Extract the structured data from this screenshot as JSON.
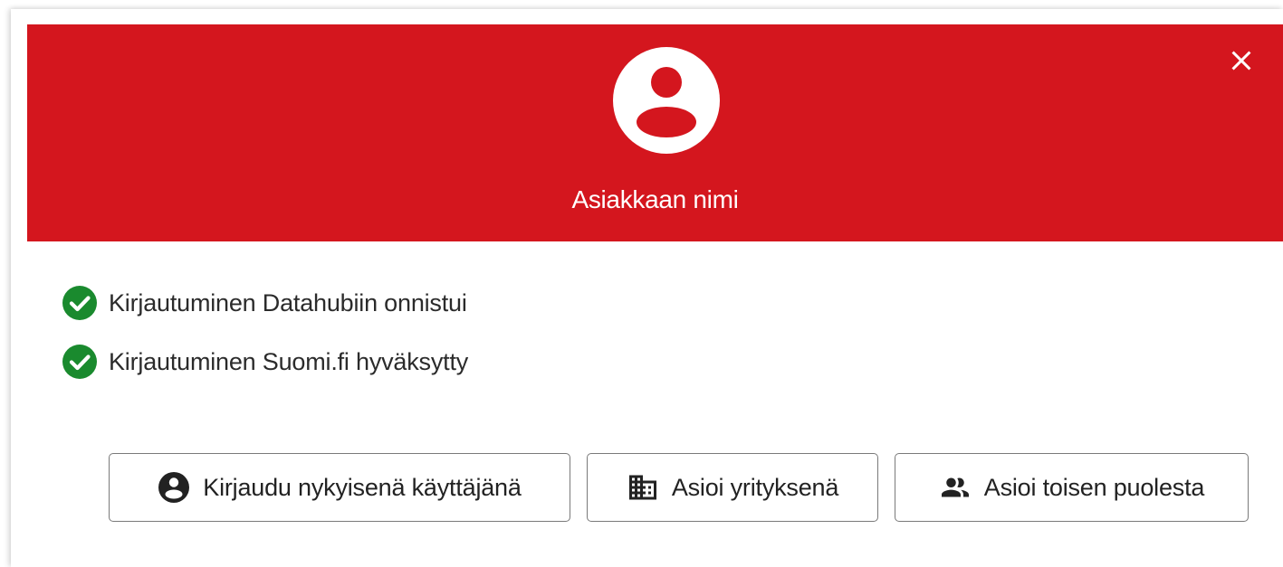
{
  "header": {
    "customer_name": "Asiakkaan nimi",
    "background_color": "#d4161e",
    "avatar_icon": "account-circle-icon",
    "close_icon": "close-icon"
  },
  "status": {
    "items": [
      {
        "icon": "check-circle-icon",
        "label": "Kirjautuminen Datahubiin onnistui"
      },
      {
        "icon": "check-circle-icon",
        "label": "Kirjautuminen Suomi.fi hyväksytty"
      }
    ],
    "success_color": "#1a8a2e"
  },
  "actions": {
    "current_user": {
      "icon": "account-circle-icon",
      "label": "Kirjaudu nykyisenä käyttäjänä"
    },
    "as_company": {
      "icon": "business-icon",
      "label": "Asioi yrityksenä"
    },
    "on_behalf": {
      "icon": "people-icon",
      "label": "Asioi toisen puolesta"
    }
  }
}
